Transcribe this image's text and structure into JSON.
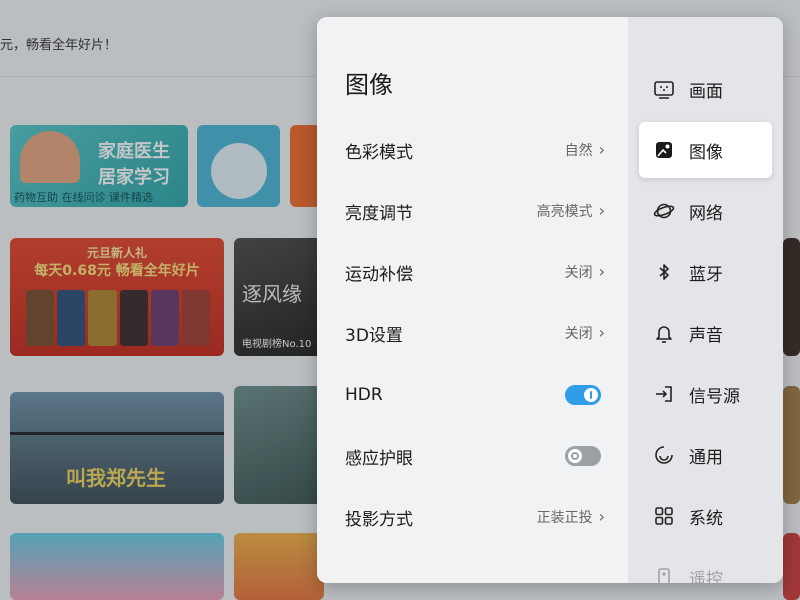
{
  "background": {
    "banner_text": "元，畅看全年好片！",
    "tiles": {
      "doctor_line1": "家庭医生",
      "doctor_line2": "居家学习",
      "doctor_line3": "药物互助 在线问诊 课件精选",
      "promo_line1": "元旦新人礼",
      "promo_line2": "每天0.68元 畅看全年好片",
      "drama_logo": "逐风缘",
      "drama_caption": "电视剧榜No.10",
      "movie_title": "叫我郑先生"
    }
  },
  "panel": {
    "title": "图像",
    "options": [
      {
        "label": "色彩模式",
        "value": "自然",
        "type": "select"
      },
      {
        "label": "亮度调节",
        "value": "高亮模式",
        "type": "select"
      },
      {
        "label": "运动补偿",
        "value": "关闭",
        "type": "select"
      },
      {
        "label": "3D设置",
        "value": "关闭",
        "type": "select"
      },
      {
        "label": "HDR",
        "type": "toggle",
        "state": "on"
      },
      {
        "label": "感应护眼",
        "type": "toggle",
        "state": "off"
      },
      {
        "label": "投影方式",
        "value": "正装正投",
        "type": "select"
      }
    ],
    "nav": [
      {
        "label": "画面",
        "icon": "screen-icon"
      },
      {
        "label": "图像",
        "icon": "image-icon",
        "selected": true
      },
      {
        "label": "网络",
        "icon": "planet-icon"
      },
      {
        "label": "蓝牙",
        "icon": "bluetooth-icon"
      },
      {
        "label": "声音",
        "icon": "bell-icon"
      },
      {
        "label": "信号源",
        "icon": "input-source-icon"
      },
      {
        "label": "通用",
        "icon": "general-icon"
      },
      {
        "label": "系统",
        "icon": "grid-icon"
      },
      {
        "label": "遥控",
        "icon": "remote-icon"
      }
    ]
  },
  "colors": {
    "accent": "#2f9de8",
    "panel_bg": "#f1f2f4",
    "nav_bg": "#e3e5e8",
    "selected_bg": "#ffffff"
  }
}
